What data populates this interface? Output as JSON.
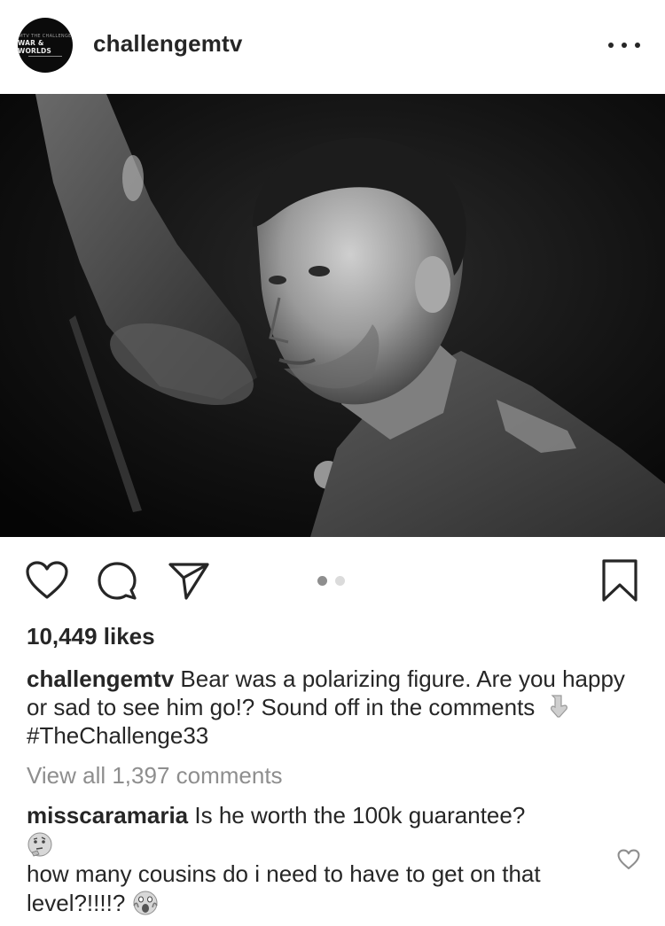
{
  "post": {
    "username": "challengemtv",
    "avatar_text": {
      "top": "MTV THE CHALLENGE",
      "main": "WAR & WORLDS"
    },
    "photo_alt": "",
    "likes": "10,449 likes",
    "caption": {
      "username": "challengemtv",
      "text_before": "Bear was a polarizing figure. Are you happy or sad to see him go!? Sound off in the comments",
      "pointing_icon": "pointing-down-icon",
      "hashtag": "#TheChallenge33"
    },
    "view_all_comments": "View all 1,397 comments",
    "comments": [
      {
        "username": "misscaramaria",
        "text_line1": "Is he worth the 100k guarantee?",
        "emoji1": "thinking-face-icon",
        "text_line2": "how many cousins do i need to have to get on that level?!!!!?",
        "emoji2": "screaming-face-icon"
      }
    ],
    "carousel": {
      "total": 2,
      "active": 1
    },
    "colors": {
      "text": "#262626",
      "muted": "#8e8e8e",
      "dot_active": "#8e8e8e",
      "dot_inactive": "#dbdbdb"
    }
  }
}
